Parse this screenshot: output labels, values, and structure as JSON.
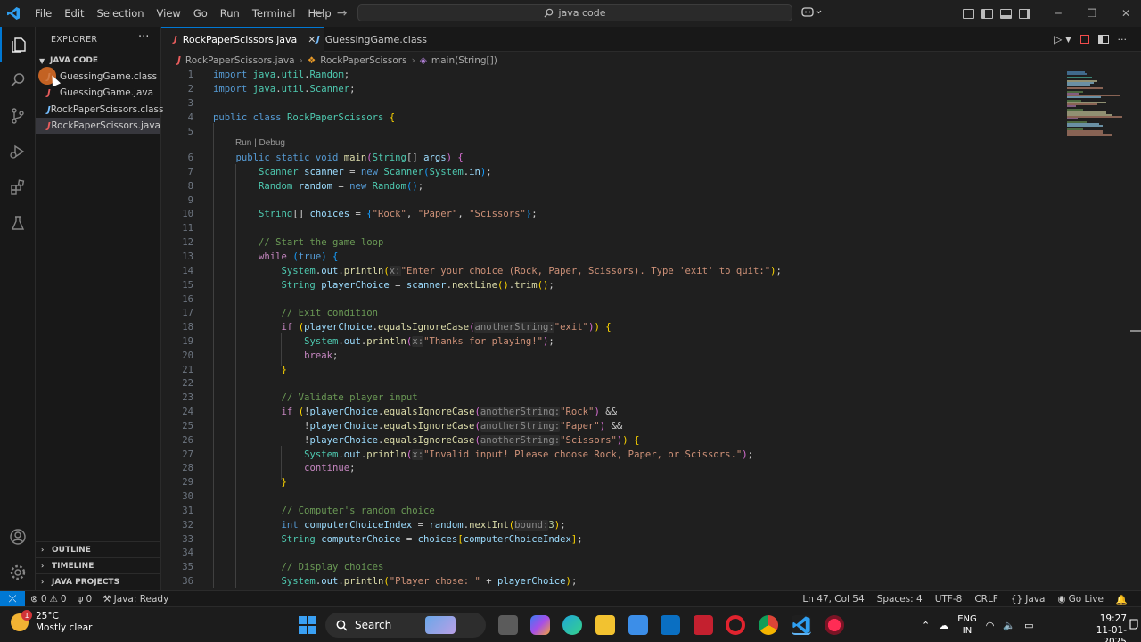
{
  "titlebar": {
    "menu": [
      "File",
      "Edit",
      "Selection",
      "View",
      "Go",
      "Run",
      "Terminal",
      "Help"
    ],
    "search": "java code"
  },
  "sidebar": {
    "title": "EXPLORER",
    "folder": "JAVA CODE",
    "files": [
      {
        "name": "GuessingGame.class",
        "kind": "class"
      },
      {
        "name": "GuessingGame.java",
        "kind": "java"
      },
      {
        "name": "RockPaperScissors.class",
        "kind": "class"
      },
      {
        "name": "RockPaperScissors.java",
        "kind": "java",
        "selected": true
      }
    ],
    "sections": [
      "OUTLINE",
      "TIMELINE",
      "JAVA PROJECTS"
    ]
  },
  "tabs": [
    {
      "label": "RockPaperScissors.java",
      "active": true
    },
    {
      "label": "GuessingGame.class",
      "active": false
    }
  ],
  "breadcrumb": [
    "RockPaperScissors.java",
    "RockPaperScissors",
    "main(String[])"
  ],
  "editor": {
    "codelens": "Run | Debug",
    "line_numbers": [
      "1",
      "2",
      "3",
      "4",
      "5",
      "6",
      "7",
      "8",
      "9",
      "10",
      "11",
      "12",
      "13",
      "14",
      "15",
      "16",
      "17",
      "18",
      "19",
      "20",
      "21",
      "22",
      "23",
      "24",
      "25",
      "26",
      "27",
      "28",
      "29",
      "30",
      "31",
      "32",
      "33",
      "34",
      "35",
      "36"
    ]
  },
  "statusbar": {
    "errors": "0",
    "warnings": "0",
    "ports": "0",
    "java": "Java: Ready",
    "position": "Ln 47, Col 54",
    "spaces": "Spaces: 4",
    "encoding": "UTF-8",
    "eol": "CRLF",
    "language": "Java",
    "golive": "Go Live"
  },
  "taskbar": {
    "temperature": "25°C",
    "weather": "Mostly clear",
    "badge": "1",
    "search": "Search",
    "lang1": "ENG",
    "lang2": "IN",
    "time": "19:27",
    "date": "11-01-2025"
  },
  "colors": {
    "accent": "#0078d4",
    "java_icon": "#e95d5d",
    "keyword": "#569cd6",
    "string": "#ce9178",
    "comment": "#6a9955"
  }
}
